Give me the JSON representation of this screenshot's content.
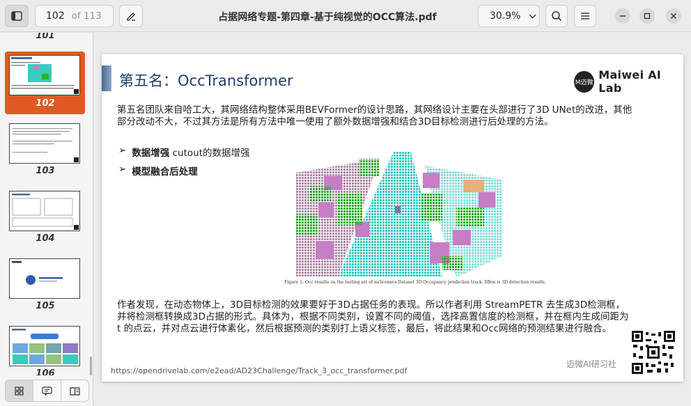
{
  "toolbar": {
    "current_page": "102",
    "total_pages": "of 113",
    "title": "占据网络专题-第四章-基于纯视觉的OCC算法.pdf",
    "zoom": "30.9%"
  },
  "sidebar": {
    "thumbnails": [
      {
        "num": "101"
      },
      {
        "num": "102",
        "selected": true
      },
      {
        "num": "103"
      },
      {
        "num": "104"
      },
      {
        "num": "105"
      },
      {
        "num": "106"
      }
    ]
  },
  "slide": {
    "title": "第五名：OccTransformer",
    "lab_name": "Maiwei AI Lab",
    "lab_short": "M迈微",
    "intro": "第五名团队来自哈工大，其网络结构整体采用BEVFormer的设计思路，其网络设计主要在头部进行了3D UNet的改进，其他部分改动不大，不过其方法是所有方法中唯一使用了额外数据增强和结合3D目标检测进行后处理的方法。",
    "bullet1_bold": "数据增强",
    "bullet1_rest": " cutout的数据增强",
    "bullet2_bold": "模型融合后处理",
    "figure_caption": "Figure 1: Occ results on the testing set of nuScenecs Dataset 3D Occupancy prediction track. BBox is 3D detection results.",
    "body": "作者发现，在动态物体上，3D目标检测的效果要好于3D占据任务的表现。所以作者利用 StreamPETR 去生成3D检测框，并将检测框转换成3D占据的形式。具体为，根据不同类别，设置不同的阈值，选择高置信度的检测框，并在框内生成间距为 t 的点云，并对点云进行体素化，然后根据预测的类别打上语义标签，最后，将此结果和Occ网络的预测结果进行融合。",
    "source_url": "https://opendrivelab.com/e2ead/AD23Challenge/Track_3_occ_transformer.pdf",
    "footer_lab": "迈微AI研习社"
  },
  "colors": {
    "accent": "#e05a24",
    "title_blue": "#1f3d6e"
  },
  "icons": [
    "sidebar-toggle-icon",
    "pen-icon",
    "chevron-down-icon",
    "search-icon",
    "hamburger-menu-icon",
    "minimize-icon",
    "maximize-icon",
    "close-icon",
    "grid-view-icon",
    "annotation-view-icon",
    "outline-view-icon"
  ]
}
